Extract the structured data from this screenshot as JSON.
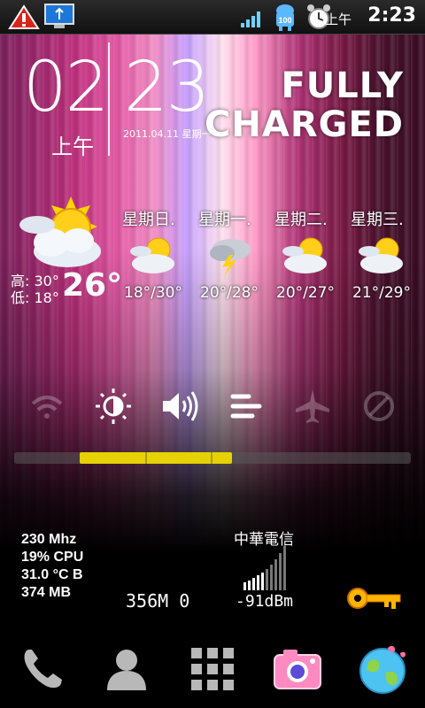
{
  "status_bar": {
    "time": "2:23",
    "ampm": "上午",
    "battery_level": "100",
    "icons": [
      "warning-icon",
      "usb-debug-icon",
      "signal-icon",
      "android-battery-icon",
      "alarm-clock-icon"
    ]
  },
  "clock": {
    "hour": "02",
    "minute": "23",
    "ampm": "上午",
    "date": "2011.04.11 星期一"
  },
  "battery_status": {
    "line1": "FULLY",
    "line2": "CHARGED"
  },
  "weather": {
    "current_temp": "26°",
    "high": "高: 30°",
    "low": "低: 18°",
    "forecast": [
      {
        "day": "星期日.",
        "temps": "18°/30°",
        "icon": "partly-cloudy-icon"
      },
      {
        "day": "星期一.",
        "temps": "20°/28°",
        "icon": "thunderstorm-icon"
      },
      {
        "day": "星期二.",
        "temps": "20°/27°",
        "icon": "partly-cloudy-icon"
      },
      {
        "day": "星期三.",
        "temps": "21°/29°",
        "icon": "partly-cloudy-icon"
      }
    ]
  },
  "power_toggles": [
    "wifi-icon",
    "brightness-icon",
    "sound-icon",
    "sync-icon",
    "airplane-icon",
    "gps-icon"
  ],
  "brightness_level": 0.65,
  "system_stats": {
    "cpu_freq": "230 Mhz",
    "cpu_usage": "19% CPU",
    "battery_temp": "31.0 °C B",
    "memory": "374 MB"
  },
  "traffic": "356M  0",
  "carrier": {
    "name": "中華電信",
    "signal": "-91dBm"
  },
  "dock": [
    "phone-icon",
    "contacts-icon",
    "app-drawer-icon",
    "camera-icon",
    "browser-globe-icon"
  ],
  "colors": {
    "slider_fill": "#e6d200",
    "pink_accent": "#e35aa6"
  }
}
